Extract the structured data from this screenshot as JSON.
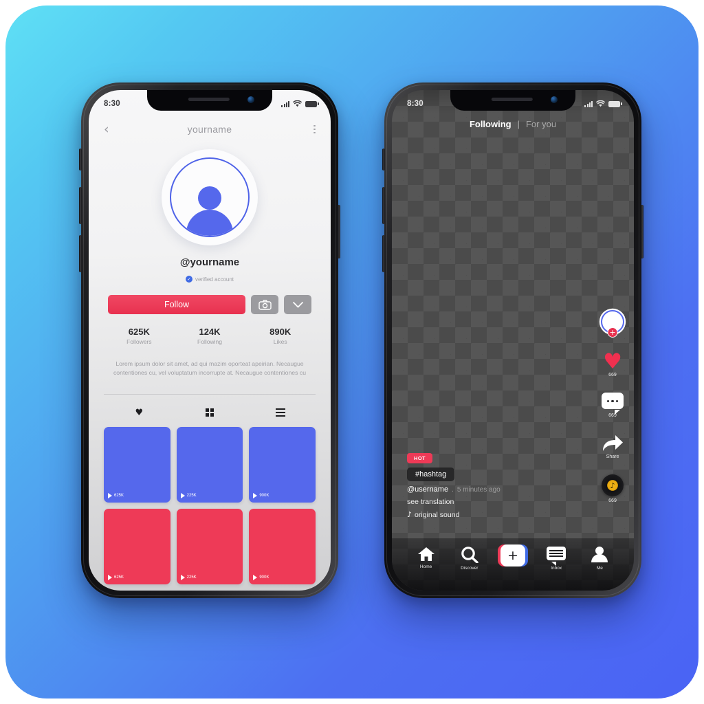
{
  "theme": {
    "bg_cyan": "#5fe0f5",
    "bg_blue": "#4a63f4",
    "accent_red": "#ee3a57",
    "accent_blue": "#5568ec"
  },
  "profile_phone": {
    "status_bar": {
      "time": "8:30",
      "signal_icon": "signal-bars-icon",
      "wifi_icon": "wifi-icon",
      "battery_icon": "battery-icon"
    },
    "nav": {
      "back_icon": "chevron-left-icon",
      "title": "yourname",
      "more_icon": "more-vertical-icon"
    },
    "avatar": {
      "icon": "user-avatar-icon"
    },
    "handle": "@yourname",
    "verified_label": "verified account",
    "verified_icon": "✓",
    "actions": {
      "follow_label": "Follow",
      "camera_icon": "camera-icon",
      "chevron_icon": "chevron-down-icon"
    },
    "stats": [
      {
        "value": "625K",
        "label": "Followers"
      },
      {
        "value": "124K",
        "label": "Following"
      },
      {
        "value": "890K",
        "label": "Likes"
      }
    ],
    "bio": "Lorem ipsum dolor sit amet, ad qui mazim oporteat apeirian. Necaugue contentiones cu, vel voluptatum incorrupte at. Necaugue contentiones cu",
    "tabs": [
      {
        "name": "liked",
        "icon": "heart-icon",
        "glyph": "♥",
        "active": true
      },
      {
        "name": "grid",
        "icon": "grid-icon",
        "active": false
      },
      {
        "name": "list",
        "icon": "list-icon",
        "active": false
      }
    ],
    "videos": [
      {
        "views": "625K",
        "color": "blue"
      },
      {
        "views": "225K",
        "color": "blue"
      },
      {
        "views": "900K",
        "color": "blue"
      },
      {
        "views": "625K",
        "color": "red"
      },
      {
        "views": "225K",
        "color": "red"
      },
      {
        "views": "900K",
        "color": "red"
      }
    ]
  },
  "feed_phone": {
    "status_bar": {
      "time": "8:30",
      "signal_icon": "signal-bars-icon",
      "wifi_icon": "wifi-icon",
      "battery_icon": "battery-icon"
    },
    "feed_tabs": {
      "following_label": "Following",
      "separator": "|",
      "foryou_label": "For you"
    },
    "rail": [
      {
        "name": "author-avatar",
        "icon": "avatar-follow-icon",
        "plus": "+",
        "count": ""
      },
      {
        "name": "like",
        "icon": "heart-icon",
        "glyph": "♥",
        "count": "669"
      },
      {
        "name": "comment",
        "icon": "comment-icon",
        "count": "669"
      },
      {
        "name": "share",
        "icon": "share-arrow-icon",
        "count": "Share"
      },
      {
        "name": "sound-disc",
        "icon": "music-disc-icon",
        "glyph": "♪",
        "count": "669"
      }
    ],
    "caption": {
      "hot_badge": "HOT",
      "hashtag": "#hashtag",
      "username": "@username",
      "separator": ".",
      "time_ago": "5 minutes ago",
      "translation_label": "see translation",
      "sound_glyph": "♪",
      "sound_label": "original sound"
    },
    "tabbar": [
      {
        "name": "home",
        "label": "Home",
        "icon": "home-icon"
      },
      {
        "name": "discover",
        "label": "Discover",
        "icon": "search-icon"
      },
      {
        "name": "create",
        "label": "",
        "icon": "plus-icon",
        "glyph": "+"
      },
      {
        "name": "inbox",
        "label": "Inbox",
        "icon": "message-icon"
      },
      {
        "name": "me",
        "label": "Me",
        "icon": "person-icon"
      }
    ]
  }
}
